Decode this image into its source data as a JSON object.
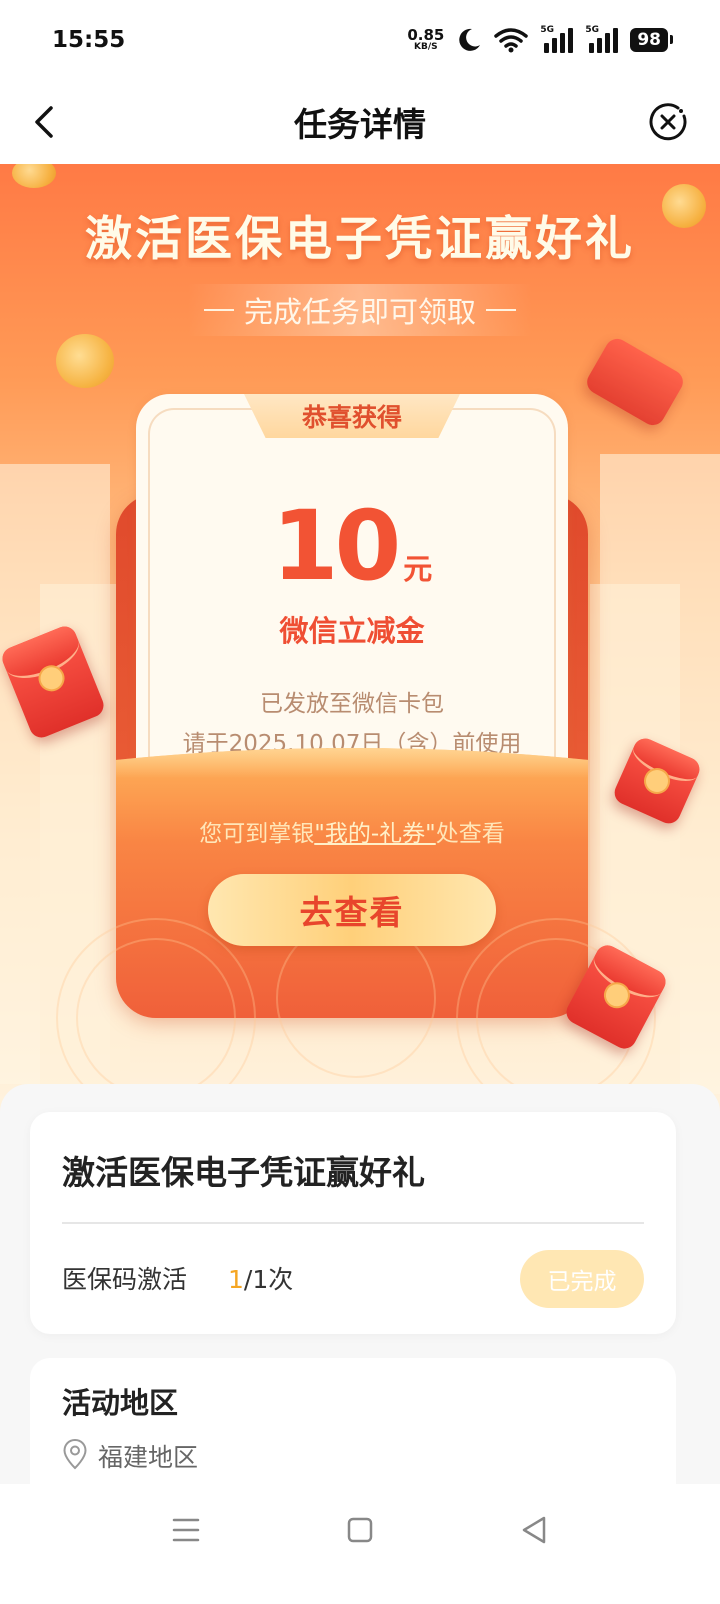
{
  "status_bar": {
    "time": "15:55",
    "net_speed_value": "0.85",
    "net_speed_unit": "KB/S",
    "signal_1_label": "5G",
    "signal_2_label": "5G",
    "battery": "98",
    "icons": [
      "moon-icon",
      "wifi-icon",
      "signal-icon",
      "signal-icon",
      "battery-icon"
    ]
  },
  "nav": {
    "title": "任务详情",
    "back_icon": "chevron-left-icon",
    "close_icon": "close-circle-icon"
  },
  "hero": {
    "title": "激活医保电子凭证赢好礼",
    "subtitle": "完成任务即可领取"
  },
  "reward": {
    "tab_label": "恭喜获得",
    "amount": "10",
    "unit": "元",
    "name": "微信立减金",
    "note_line1": "已发放至微信卡包",
    "note_line2": "请于2025.10.07日（含）前使用",
    "hint_prefix": "您可到掌银",
    "hint_link": "\"我的-礼券\"",
    "hint_suffix": "处查看",
    "view_button": "去查看"
  },
  "task": {
    "title": "激活医保电子凭证赢好礼",
    "item_name": "医保码激活",
    "progress_done": "1",
    "progress_total": "/1次",
    "status_button": "已完成"
  },
  "region": {
    "title": "活动地区",
    "icon": "location-pin-icon",
    "name": "福建地区"
  },
  "system_nav": {
    "icons": [
      "menu-icon",
      "home-square-icon",
      "back-triangle-icon"
    ]
  },
  "colors": {
    "accent": "#f25334",
    "hero_top": "#ff7a45",
    "gold": "#f5a623",
    "done_button": "#ffe7b3"
  }
}
